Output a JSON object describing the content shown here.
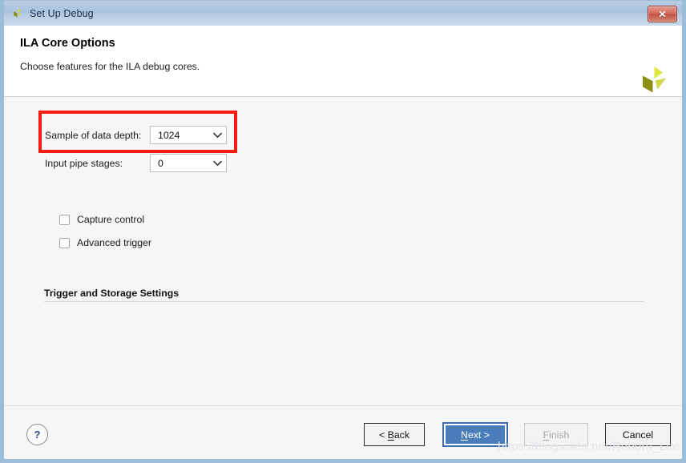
{
  "window": {
    "title": "Set Up Debug",
    "title_icon": "xilinx-logo-icon",
    "close_label": "✕"
  },
  "header": {
    "title": "ILA Core Options",
    "subtitle": "Choose features for the ILA debug cores.",
    "logo_icon": "xilinx-brand-logo-icon"
  },
  "form": {
    "sample_depth": {
      "label": "Sample of data depth:",
      "value": "1024"
    },
    "pipe_stages": {
      "label": "Input pipe stages:",
      "value": "0"
    },
    "group": {
      "title": "Trigger and Storage Settings"
    },
    "checkboxes": [
      {
        "label": "Capture control",
        "checked": false
      },
      {
        "label": "Advanced trigger",
        "checked": false
      }
    ]
  },
  "footer": {
    "help_label": "?",
    "buttons": [
      {
        "name": "back",
        "prefix": "< ",
        "accel": "B",
        "suffix": "ack",
        "state": "normal"
      },
      {
        "name": "next",
        "prefix": "",
        "accel": "N",
        "suffix": "ext >",
        "state": "default"
      },
      {
        "name": "finish",
        "prefix": "",
        "accel": "F",
        "suffix": "inish",
        "state": "disabled"
      },
      {
        "name": "cancel",
        "prefix": "",
        "accel": "",
        "suffix": "Cancel",
        "state": "normal"
      }
    ]
  },
  "watermark": {
    "text": "https://blog.csdn.net/Reborn_Lee"
  },
  "colors": {
    "highlight": "#f41a10",
    "default_button": "#4a7ebb",
    "titlebar": "#aec6de",
    "logo_light": "#d6df3c",
    "logo_dark": "#8e9215"
  }
}
